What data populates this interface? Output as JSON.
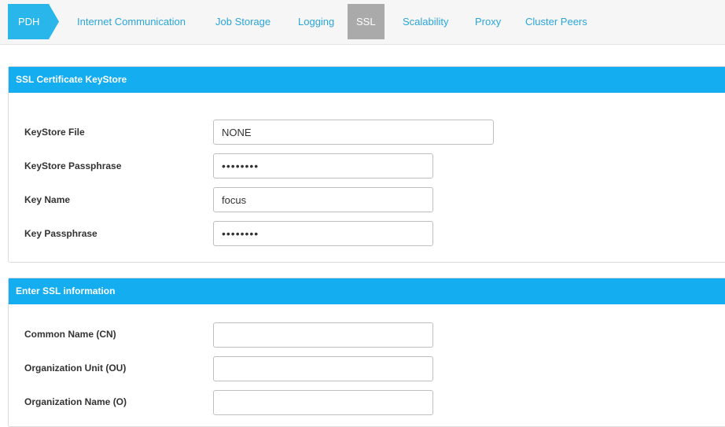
{
  "tabs": {
    "pdh": "PDH",
    "items": [
      "Internet Communication",
      "Job Storage",
      "Logging",
      "SSL",
      "Scalability",
      "Proxy",
      "Cluster Peers"
    ],
    "active": "SSL"
  },
  "keystore_panel": {
    "title": "SSL Certificate KeyStore",
    "fields": [
      {
        "label": "KeyStore File",
        "value": "NONE"
      },
      {
        "label": "KeyStore Passphrase",
        "value": "••••••••"
      },
      {
        "label": "Key Name",
        "value": "focus"
      },
      {
        "label": "Key Passphrase",
        "value": "••••••••"
      }
    ]
  },
  "ssl_panel": {
    "title": "Enter SSL information",
    "fields": [
      {
        "label": "Common Name (CN)",
        "value": ""
      },
      {
        "label": "Organization Unit (OU)",
        "value": ""
      },
      {
        "label": "Organization Name (O)",
        "value": ""
      }
    ]
  },
  "colors": {
    "accent": "#14adef",
    "tab_text": "#2aa6d9",
    "active_tab": "#aaaaaa"
  }
}
